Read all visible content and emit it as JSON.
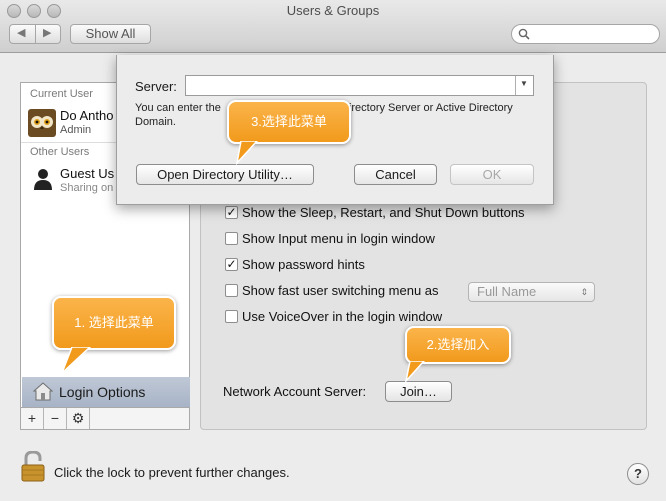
{
  "window": {
    "title": "Users & Groups",
    "show_all": "Show All",
    "nav_back": "◀",
    "nav_forward": "▶"
  },
  "sidebar": {
    "current_user_header": "Current User",
    "current_user": {
      "name": "Do Antho",
      "role": "Admin"
    },
    "other_users_header": "Other Users",
    "other_user": {
      "name": "Guest Us",
      "role": "Sharing on"
    },
    "login_options": "Login Options",
    "add": "+",
    "remove": "−",
    "gear": "⚙"
  },
  "login_options": {
    "options": [
      {
        "label": "Show the Sleep, Restart, and Shut Down buttons",
        "checked": true
      },
      {
        "label": "Show Input menu in login window",
        "checked": false
      },
      {
        "label": "Show password hints",
        "checked": true
      },
      {
        "label": "Show fast user switching menu as",
        "checked": false
      },
      {
        "label": "Use VoiceOver in the login window",
        "checked": false
      }
    ],
    "fast_switch_value": "Full Name",
    "network_account_label": "Network Account Server:",
    "join_button": "Join…"
  },
  "sheet": {
    "server_label": "Server:",
    "server_value": "",
    "help_text_1": "You can enter the",
    "help_text_2": "Directory Server or Active Directory",
    "help_text_3": "Domain.",
    "open_utility": "Open Directory Utility…",
    "cancel": "Cancel",
    "ok": "OK"
  },
  "footer": {
    "lock_text": "Click the lock to prevent further changes.",
    "help": "?"
  },
  "callouts": {
    "step1": "1. 选择此菜单",
    "step2": "2.选择加入",
    "step3": "3.选择此菜单"
  },
  "colors": {
    "callout": "#f5a42c",
    "selected_row": "#b3bdcd"
  }
}
